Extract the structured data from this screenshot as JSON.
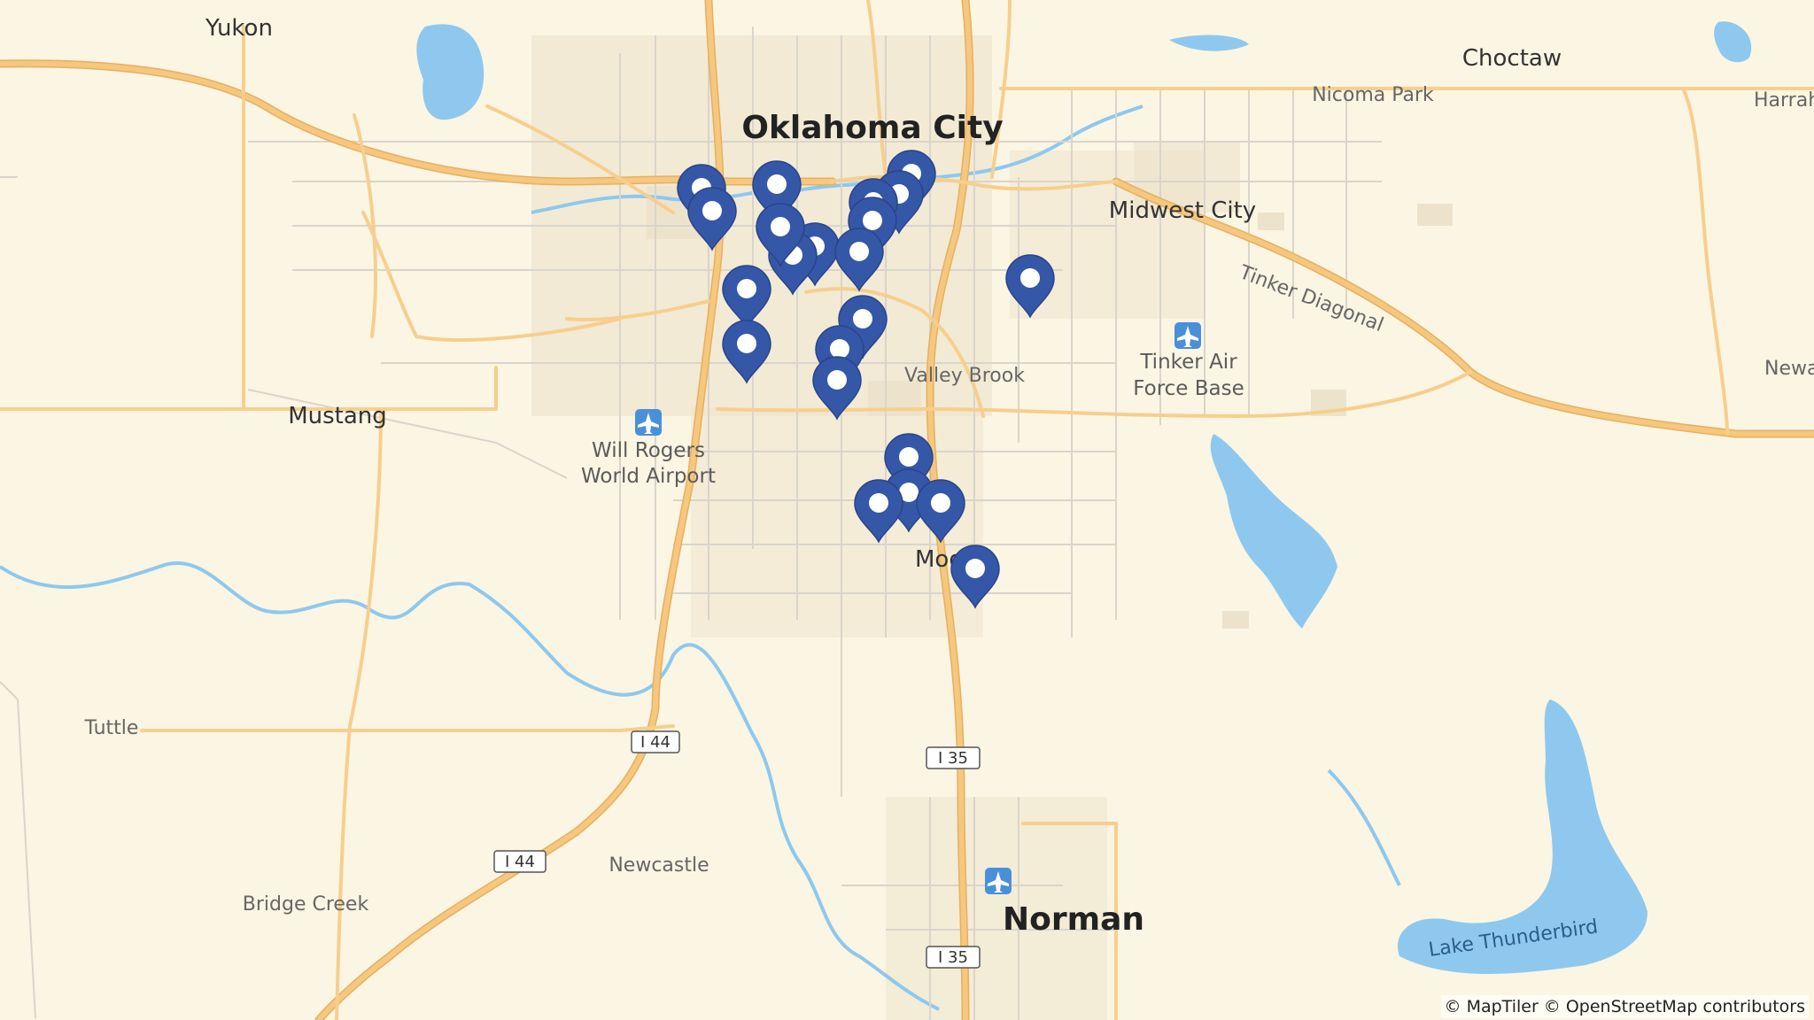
{
  "map": {
    "labels": {
      "oklahoma_city": "Oklahoma City",
      "norman": "Norman",
      "yukon": "Yukon",
      "choctaw": "Choctaw",
      "nicoma_park": "Nicoma Park",
      "harrah": "Harrah",
      "midwest_city": "Midwest City",
      "mustang": "Mustang",
      "valley_brook": "Valley Brook",
      "tinker_line1": "Tinker Air",
      "tinker_line2": "Force Base",
      "airport_line1": "Will Rogers",
      "airport_line2": "World Airport",
      "newalla": "Newall",
      "moore": "Moo",
      "tuttle": "Tuttle",
      "newcastle": "Newcastle",
      "bridge_creek": "Bridge Creek",
      "tinker_diagonal": "Tinker Diagonal",
      "lake_thunderbird": "Lake Thunderbird"
    },
    "shields": {
      "i44_a": "I 44",
      "i44_b": "I 44",
      "i35_a": "I 35",
      "i35_b": "I 35"
    },
    "marker_count": 23,
    "colors": {
      "background": "#fbf5e3",
      "major_road": "#f6c77e",
      "minor_road": "#d9d5cc",
      "water": "#8ec8ee",
      "urban": "#ede3cc",
      "marker": "#3557a8"
    }
  },
  "attribution": "© MapTiler © OpenStreetMap contributors"
}
